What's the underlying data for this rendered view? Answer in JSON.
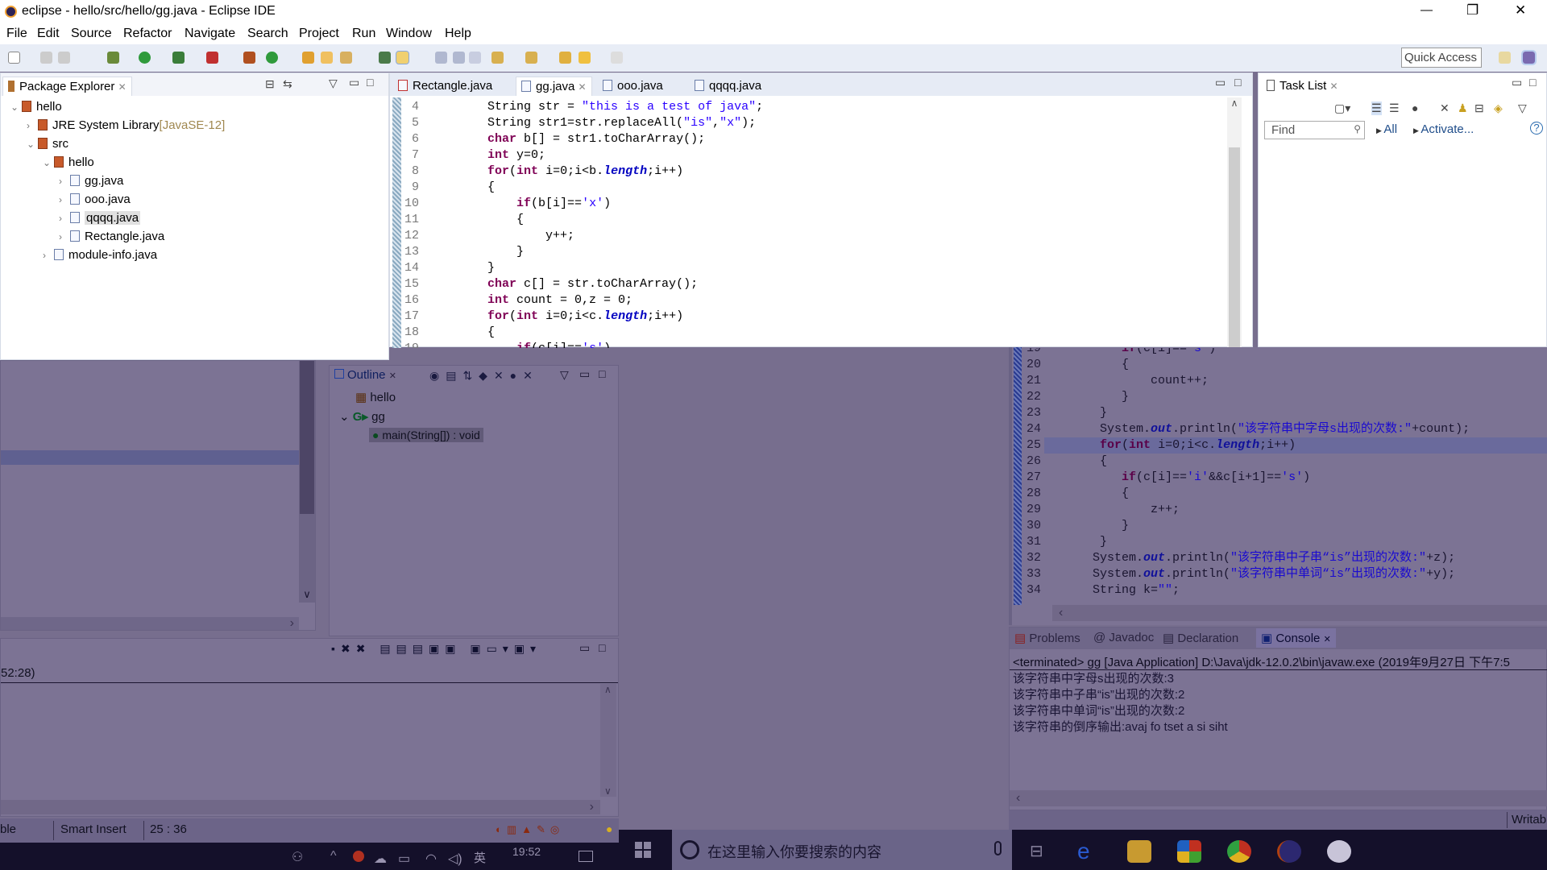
{
  "window": {
    "title": "eclipse - hello/src/hello/gg.java - Eclipse IDE",
    "minimize": "—",
    "restore": "❐",
    "close": "✕"
  },
  "menu": [
    "File",
    "Edit",
    "Source",
    "Refactor",
    "Navigate",
    "Search",
    "Project",
    "Run",
    "Window",
    "Help"
  ],
  "toolbar": {
    "quick_access": "Quick Access"
  },
  "package_explorer": {
    "title": "Package Explorer",
    "tree": [
      {
        "label": "hello",
        "level": 0,
        "expanded": true
      },
      {
        "label": "JRE System Library",
        "suffix": "[JavaSE-12]",
        "level": 1,
        "expanded": false
      },
      {
        "label": "src",
        "level": 1,
        "expanded": true
      },
      {
        "label": "hello",
        "level": 2,
        "expanded": true
      },
      {
        "label": "gg.java",
        "level": 3,
        "expanded": false
      },
      {
        "label": "ooo.java",
        "level": 3,
        "expanded": false
      },
      {
        "label": "qqqq.java",
        "level": 3,
        "expanded": false,
        "selected": true
      },
      {
        "label": "Rectangle.java",
        "level": 3,
        "expanded": false
      },
      {
        "label": "module-info.java",
        "level": 2,
        "expanded": false
      }
    ]
  },
  "editor": {
    "tabs": [
      {
        "label": "Rectangle.java",
        "active": false
      },
      {
        "label": "gg.java",
        "active": true
      },
      {
        "label": "ooo.java",
        "active": false
      },
      {
        "label": "qqqq.java",
        "active": false
      }
    ],
    "lines_top": [
      {
        "n": "4",
        "t": [
          [
            "p",
            "        "
          ],
          [
            "p",
            "String str = "
          ],
          [
            "s",
            "\"this is a test of java\""
          ],
          [
            "p",
            ";"
          ]
        ]
      },
      {
        "n": "5",
        "t": [
          [
            "p",
            "        String str1=str.replaceAll("
          ],
          [
            "s",
            "\"is\""
          ],
          [
            "p",
            ","
          ],
          [
            "s",
            "\"x\""
          ],
          [
            "p",
            ");"
          ]
        ]
      },
      {
        "n": "6",
        "t": [
          [
            "p",
            "        "
          ],
          [
            "k",
            "char"
          ],
          [
            "p",
            " b[] = str1.toCharArray();"
          ]
        ]
      },
      {
        "n": "7",
        "t": [
          [
            "p",
            "        "
          ],
          [
            "k",
            "int"
          ],
          [
            "p",
            " y=0;"
          ]
        ]
      },
      {
        "n": "8",
        "t": [
          [
            "p",
            "        "
          ],
          [
            "k",
            "for"
          ],
          [
            "p",
            "("
          ],
          [
            "k",
            "int"
          ],
          [
            "p",
            " i=0;i<b."
          ],
          [
            "f",
            "length"
          ],
          [
            "p",
            ";i++)"
          ]
        ]
      },
      {
        "n": "9",
        "t": [
          [
            "p",
            "        {"
          ]
        ]
      },
      {
        "n": "10",
        "t": [
          [
            "p",
            "            "
          ],
          [
            "k",
            "if"
          ],
          [
            "p",
            "(b[i]=="
          ],
          [
            "s",
            "'x'"
          ],
          [
            "p",
            ")"
          ]
        ]
      },
      {
        "n": "11",
        "t": [
          [
            "p",
            "            {"
          ]
        ]
      },
      {
        "n": "12",
        "t": [
          [
            "p",
            "                y++;"
          ]
        ]
      },
      {
        "n": "13",
        "t": [
          [
            "p",
            "            }"
          ]
        ]
      },
      {
        "n": "14",
        "t": [
          [
            "p",
            "        }"
          ]
        ]
      },
      {
        "n": "15",
        "t": [
          [
            "p",
            "        "
          ],
          [
            "k",
            "char"
          ],
          [
            "p",
            " c[] = str.toCharArray();"
          ]
        ]
      },
      {
        "n": "16",
        "t": [
          [
            "p",
            "        "
          ],
          [
            "k",
            "int"
          ],
          [
            "p",
            " count = 0,z = 0;"
          ]
        ]
      },
      {
        "n": "17",
        "t": [
          [
            "p",
            "        "
          ],
          [
            "k",
            "for"
          ],
          [
            "p",
            "("
          ],
          [
            "k",
            "int"
          ],
          [
            "p",
            " i=0;i<c."
          ],
          [
            "f",
            "length"
          ],
          [
            "p",
            ";i++)"
          ]
        ]
      },
      {
        "n": "18",
        "t": [
          [
            "p",
            "        {"
          ]
        ]
      },
      {
        "n": "19",
        "t": [
          [
            "p",
            "            "
          ],
          [
            "k",
            "if"
          ],
          [
            "p",
            "(c[i]=="
          ],
          [
            "s",
            "'s'"
          ],
          [
            "p",
            ")"
          ]
        ]
      }
    ],
    "lines_bottom": [
      {
        "n": "19",
        "t": [
          [
            "p",
            "    "
          ],
          [
            "k",
            "if"
          ],
          [
            "p",
            "(c[i]=="
          ],
          [
            "s",
            "'s'"
          ],
          [
            "p",
            ")"
          ]
        ]
      },
      {
        "n": "20",
        "t": [
          [
            "p",
            "    {"
          ]
        ]
      },
      {
        "n": "21",
        "t": [
          [
            "p",
            "        count++;"
          ]
        ]
      },
      {
        "n": "22",
        "t": [
          [
            "p",
            "    }"
          ]
        ]
      },
      {
        "n": "23",
        "t": [
          [
            "p",
            " }"
          ]
        ]
      },
      {
        "n": "24",
        "t": [
          [
            "p",
            " System."
          ],
          [
            "f",
            "out"
          ],
          [
            "p",
            ".println("
          ],
          [
            "s",
            "\"该字符串中字母s出现的次数:\""
          ],
          [
            "p",
            "+count);"
          ]
        ]
      },
      {
        "n": "25",
        "t": [
          [
            "p",
            " "
          ],
          [
            "k",
            "for"
          ],
          [
            "p",
            "("
          ],
          [
            "k",
            "int"
          ],
          [
            "p",
            " i=0;i<c."
          ],
          [
            "f",
            "length"
          ],
          [
            "p",
            ";i++)"
          ]
        ],
        "current": true
      },
      {
        "n": "26",
        "t": [
          [
            "p",
            " {"
          ]
        ]
      },
      {
        "n": "27",
        "t": [
          [
            "p",
            "    "
          ],
          [
            "k",
            "if"
          ],
          [
            "p",
            "(c[i]=="
          ],
          [
            "s",
            "'i'"
          ],
          [
            "p",
            "&&c[i+1]=="
          ],
          [
            "s",
            "'s'"
          ],
          [
            "p",
            ")"
          ]
        ]
      },
      {
        "n": "28",
        "t": [
          [
            "p",
            "    {"
          ]
        ]
      },
      {
        "n": "29",
        "t": [
          [
            "p",
            "        z++;"
          ]
        ]
      },
      {
        "n": "30",
        "t": [
          [
            "p",
            "    }"
          ]
        ]
      },
      {
        "n": "31",
        "t": [
          [
            "p",
            " }"
          ]
        ]
      },
      {
        "n": "32",
        "t": [
          [
            "p",
            "System."
          ],
          [
            "f",
            "out"
          ],
          [
            "p",
            ".println("
          ],
          [
            "s",
            "\"该字符串中子串“is”出现的次数:\""
          ],
          [
            "p",
            "+z);"
          ]
        ]
      },
      {
        "n": "33",
        "t": [
          [
            "p",
            "System."
          ],
          [
            "f",
            "out"
          ],
          [
            "p",
            ".println("
          ],
          [
            "s",
            "\"该字符串中单词“is”出现的次数:\""
          ],
          [
            "p",
            "+y);"
          ]
        ]
      },
      {
        "n": "34",
        "t": [
          [
            "p",
            "String k="
          ],
          [
            "s",
            "\"\""
          ],
          [
            "p",
            ";"
          ]
        ]
      }
    ]
  },
  "task_list": {
    "title": "Task List",
    "find_placeholder": "Find",
    "all": "All",
    "activate": "Activate..."
  },
  "outline": {
    "title": "Outline",
    "items": [
      {
        "label": "hello",
        "icon": "package-icon"
      },
      {
        "label": "gg",
        "icon": "class-icon"
      },
      {
        "label": "main(String[]) : void",
        "icon": "method-icon",
        "selected": true
      }
    ]
  },
  "left_bottom": {
    "partial_text": "52:28)"
  },
  "console": {
    "tabs": [
      "Problems",
      "Javadoc",
      "Declaration",
      "Console"
    ],
    "active_tab": "Console",
    "header": "<terminated> gg [Java Application] D:\\Java\\jdk-12.0.2\\bin\\javaw.exe (2019年9月27日 下午7:5",
    "output": [
      "该字符串中字母s出现的次数:3",
      "该字符串中子串“is”出现的次数:2",
      "该字符串中单词“is”出现的次数:2",
      "该字符串的倒序输出:avaj fo tset a si siht"
    ]
  },
  "status_bar": {
    "writable": "ble",
    "insert_mode": "Smart Insert",
    "position": "25 : 36",
    "writable_right": "Writab"
  },
  "taskbar": {
    "search_placeholder": "在这里输入你要搜索的内容",
    "time": "19:52",
    "ime": "英"
  },
  "colors": {
    "keyword": "#7f0055",
    "string": "#2a00ff",
    "field": "#0000c0",
    "overlay": "#776e8e",
    "taskbar": "#14102a"
  }
}
